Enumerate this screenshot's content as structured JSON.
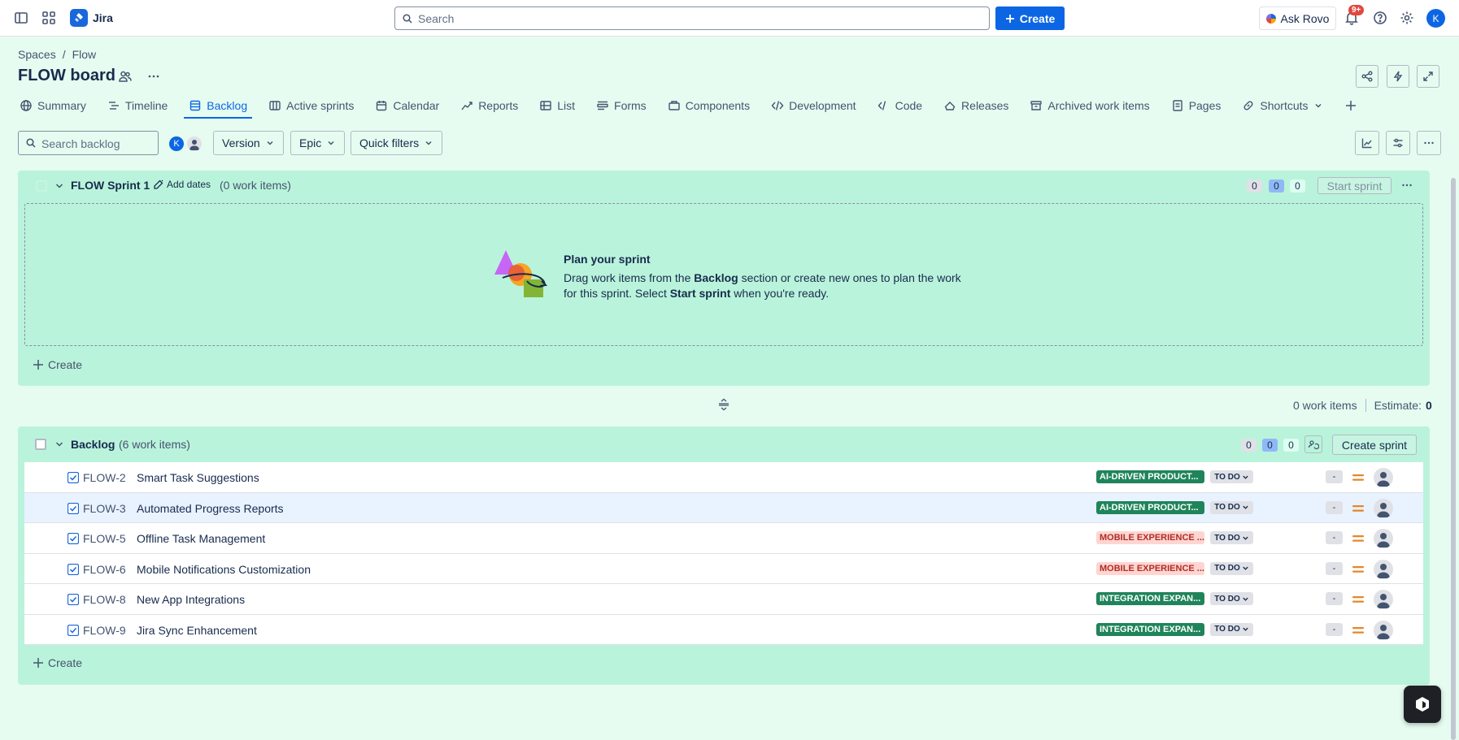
{
  "topnav": {
    "brand": "Jira",
    "search_placeholder": "Search",
    "create_label": "Create",
    "rovo_label": "Ask Rovo",
    "notifications_badge": "9+",
    "avatar_initial": "K"
  },
  "breadcrumb": {
    "items": [
      "Spaces",
      "Flow"
    ],
    "separator": "/"
  },
  "page": {
    "title": "FLOW board"
  },
  "tabs": [
    {
      "label": "Summary",
      "icon": "globe-icon"
    },
    {
      "label": "Timeline",
      "icon": "timeline-icon"
    },
    {
      "label": "Backlog",
      "icon": "backlog-icon",
      "active": true
    },
    {
      "label": "Active sprints",
      "icon": "board-icon"
    },
    {
      "label": "Calendar",
      "icon": "calendar-icon"
    },
    {
      "label": "Reports",
      "icon": "reports-icon"
    },
    {
      "label": "List",
      "icon": "list-icon"
    },
    {
      "label": "Forms",
      "icon": "forms-icon"
    },
    {
      "label": "Components",
      "icon": "components-icon"
    },
    {
      "label": "Development",
      "icon": "development-icon"
    },
    {
      "label": "Code",
      "icon": "code-icon"
    },
    {
      "label": "Releases",
      "icon": "ship-icon"
    },
    {
      "label": "Archived work items",
      "icon": "archive-icon"
    },
    {
      "label": "Pages",
      "icon": "page-icon"
    },
    {
      "label": "Shortcuts",
      "icon": "link-icon"
    }
  ],
  "filters": {
    "search_placeholder": "Search backlog",
    "avatar_initial": "K",
    "version_label": "Version",
    "epic_label": "Epic",
    "quick_filters_label": "Quick filters"
  },
  "sprint": {
    "name": "FLOW Sprint 1",
    "add_dates_label": "Add dates",
    "count_label": "(0 work items)",
    "counts": {
      "todo": "0",
      "in_progress": "0",
      "done": "0"
    },
    "start_label": "Start sprint",
    "plan_title": "Plan your sprint",
    "plan_desc_1": "Drag work items from the ",
    "plan_desc_bold1": "Backlog",
    "plan_desc_2": " section or create new ones to plan the work for this sprint. Select ",
    "plan_desc_bold2": "Start sprint",
    "plan_desc_3": " when you're ready.",
    "create_label": "Create"
  },
  "totals": {
    "work_items": "0 work items",
    "estimate_label": "Estimate:",
    "estimate_value": "0"
  },
  "backlog": {
    "name": "Backlog",
    "count_label": "(6 work items)",
    "counts": {
      "todo": "0",
      "in_progress": "0",
      "done": "0"
    },
    "create_sprint_label": "Create sprint",
    "create_label": "Create",
    "items": [
      {
        "key": "FLOW-2",
        "summary": "Smart Task Suggestions",
        "epic": "AI-DRIVEN PRODUCT...",
        "epic_color": "#1f845a",
        "status": "TO DO",
        "estimate": "-"
      },
      {
        "key": "FLOW-3",
        "summary": "Automated Progress Reports",
        "epic": "AI-DRIVEN PRODUCT...",
        "epic_color": "#1f845a",
        "status": "TO DO",
        "estimate": "-"
      },
      {
        "key": "FLOW-5",
        "summary": "Offline Task Management",
        "epic": "MOBILE EXPERIENCE ...",
        "epic_color": "#ffd5d2",
        "status": "TO DO",
        "estimate": "-"
      },
      {
        "key": "FLOW-6",
        "summary": "Mobile Notifications Customization",
        "epic": "MOBILE EXPERIENCE ...",
        "epic_color": "#ffd5d2",
        "status": "TO DO",
        "estimate": "-"
      },
      {
        "key": "FLOW-8",
        "summary": "New App Integrations",
        "epic": "INTEGRATION EXPAN...",
        "epic_color": "#1f845a",
        "status": "TO DO",
        "estimate": "-"
      },
      {
        "key": "FLOW-9",
        "summary": "Jira Sync Enhancement",
        "epic": "INTEGRATION EXPAN...",
        "epic_color": "#1f845a",
        "status": "TO DO",
        "estimate": "-"
      }
    ]
  },
  "colors": {
    "accent": "#0c66e4",
    "board_bg": "#e6fcf0",
    "section_bg": "#baf3db",
    "priority_medium": "#e2882a"
  }
}
